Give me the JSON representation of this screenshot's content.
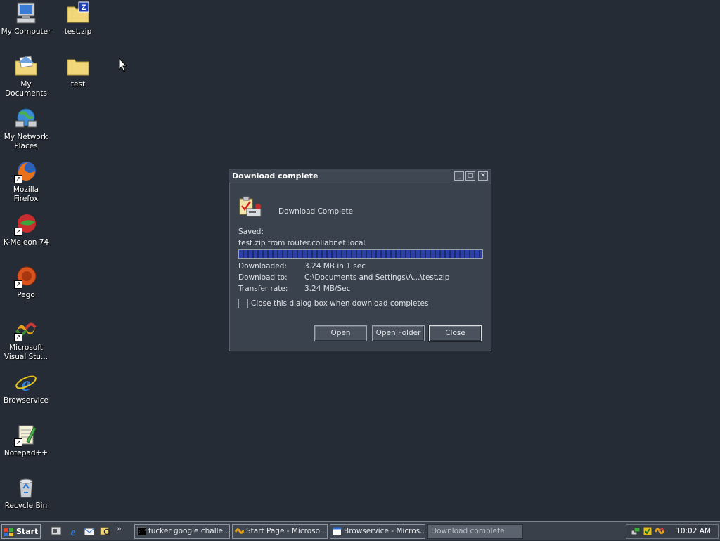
{
  "desktop": {
    "icons": [
      {
        "label": "My Computer"
      },
      {
        "label": "test.zip"
      },
      {
        "label": "My Documents"
      },
      {
        "label": "test"
      },
      {
        "label": "My Network\nPlaces"
      },
      {
        "label": "Mozilla Firefox"
      },
      {
        "label": "K-Meleon 74"
      },
      {
        "label": "Pego"
      },
      {
        "label": "Microsoft\nVisual Stu..."
      },
      {
        "label": "Browservice"
      },
      {
        "label": "Notepad++"
      },
      {
        "label": "Recycle Bin"
      }
    ]
  },
  "dialog": {
    "title": "Download complete",
    "heading": "Download Complete",
    "saved_label": "Saved:",
    "saved_value": "test.zip from router.collabnet.local",
    "progress": 1.0,
    "downloaded_label": "Downloaded:",
    "downloaded_value": "3.24 MB in 1 sec",
    "download_to_label": "Download to:",
    "download_to_value": "C:\\Documents and Settings\\A...\\test.zip",
    "transfer_rate_label": "Transfer rate:",
    "transfer_rate_value": "3.24 MB/Sec",
    "close_checkbox_label": "Close this dialog box when download completes",
    "close_checkbox_checked": false,
    "open_button": "Open",
    "open_folder_button": "Open Folder",
    "close_button": "Close"
  },
  "taskbar": {
    "start_label": "Start",
    "quicklaunch_more": "»",
    "tasks": [
      {
        "label": "fucker google challe...",
        "active": false
      },
      {
        "label": "Start Page - Microso...",
        "active": false
      },
      {
        "label": "Browservice - Micros...",
        "active": false
      },
      {
        "label": "Download complete",
        "active": true
      }
    ],
    "clock": "10:02 AM"
  },
  "colors": {
    "desktop_bg": "#262c35",
    "dialog_bg": "#3a424d",
    "progress_fill": "#2a3fa8"
  }
}
